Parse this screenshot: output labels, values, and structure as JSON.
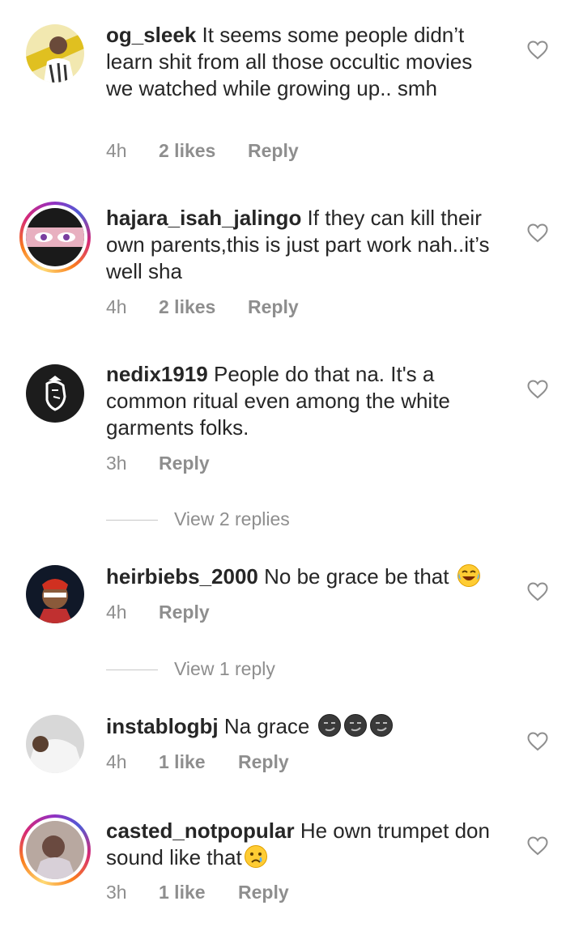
{
  "comments": [
    {
      "username": "og_sleek",
      "text": " It seems some people didn’t learn shit from all those occultic movies we watched while growing up.. smh",
      "time": "4h",
      "likes": "2 likes",
      "reply": "Reply"
    },
    {
      "username": "hajara_isah_jalingo",
      "text": " If they can kill their own parents,this is just part work nah..it’s well sha",
      "time": "4h",
      "likes": "2 likes",
      "reply": "Reply"
    },
    {
      "username": "nedix1919",
      "text": " People do that na. It's a common ritual even among the white garments folks.",
      "time": "3h",
      "likes": "",
      "reply": "Reply",
      "view_replies": "View 2 replies"
    },
    {
      "username": "heirbiebs_2000",
      "text": " No be grace be that ",
      "time": "4h",
      "likes": "",
      "reply": "Reply",
      "view_replies": "View 1 reply"
    },
    {
      "username": "instablogbj",
      "text": " Na grace ",
      "time": "4h",
      "likes": "1 like",
      "reply": "Reply"
    },
    {
      "username": "casted_notpopular",
      "text": " He own trumpet don sound like that",
      "time": "3h",
      "likes": "1 like",
      "reply": "Reply"
    }
  ],
  "icons": {
    "like": "heart-outline-icon",
    "emoji_laugh": "face-with-tears-of-joy",
    "emoji_smirk": "dark-smirking-face",
    "emoji_cry": "crying-face"
  }
}
